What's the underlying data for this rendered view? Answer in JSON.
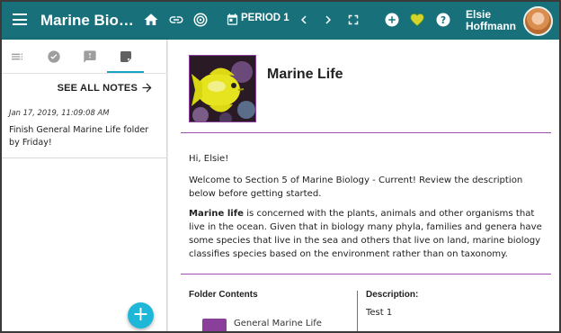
{
  "topbar": {
    "app_title": "Marine Biology - Current",
    "period_label": "PERIOD 1",
    "user_name": "Elsie Hoffmann",
    "icons": [
      "menu-icon",
      "home-icon",
      "link-icon",
      "target-icon",
      "calendar-icon",
      "chevron-left-icon",
      "chevron-right-icon",
      "fullscreen-icon",
      "add-icon",
      "heart-icon",
      "help-icon"
    ]
  },
  "left_panel": {
    "tabs": [
      {
        "name": "list",
        "icon": "list-icon"
      },
      {
        "name": "check",
        "icon": "check-circle-icon"
      },
      {
        "name": "alerts",
        "icon": "alert-icon"
      },
      {
        "name": "notes",
        "icon": "note-icon",
        "active": true
      }
    ],
    "see_all_notes": "SEE ALL NOTES",
    "note": {
      "timestamp": "Jan 17, 2019, 11:09:08 AM",
      "text": "Finish General Marine Life folder by Friday!"
    },
    "fab_label": "+"
  },
  "main": {
    "title": "Marine Life",
    "greeting": "Hi, Elsie!",
    "welcome": "Welcome to Section 5 of Marine Biology - Current! Review the description below before getting started.",
    "description_bold": "Marine life",
    "description_rest": " is concerned with the plants, animals and other organisms that live in the ocean. Given that in biology many phyla, families and genera have some species that live in the sea and others that live on land, marine biology classifies species based on the environment rather than on taxonomy.",
    "folder_contents_heading": "Folder Contents",
    "description_heading": "Description:",
    "description_value": "Test 1",
    "folder_items": [
      "General Marine Life"
    ]
  },
  "colors": {
    "topbar": "#17707a",
    "accent_purple": "#9b4fb0",
    "fab": "#1fb7d8",
    "heart": "#d4d42a"
  }
}
